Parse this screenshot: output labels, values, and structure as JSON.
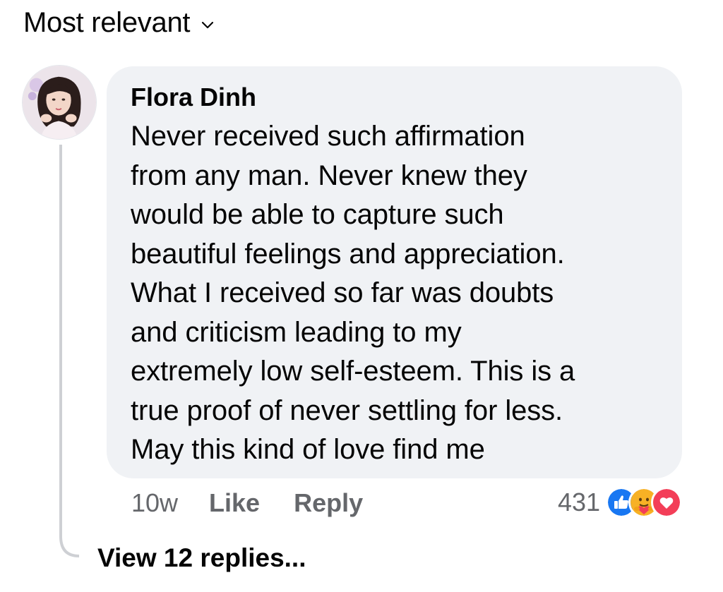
{
  "sort": {
    "label": "Most relevant",
    "icon": "chevron-down-icon"
  },
  "comment": {
    "author": "Flora Dinh",
    "text": "Never received such affirmation\nfrom any man. Never knew they\nwould be able to capture such\nbeautiful feelings and appreciation.\nWhat I received so far was doubts\nand criticism leading to my\nextremely low self-esteem. This is a\ntrue proof of never settling for less.\nMay this kind of love find me",
    "time": "10w",
    "like_label": "Like",
    "reply_label": "Reply",
    "reaction_count": "431",
    "reaction_icons": [
      "like-icon",
      "care-icon",
      "love-icon"
    ],
    "view_replies": "View 12 replies..."
  },
  "colors": {
    "bubble": "#f0f2f5",
    "secondary_text": "#65676b",
    "like_blue": "#1877f2",
    "love_red": "#f33e58",
    "care_yellow": "#f7b125"
  }
}
